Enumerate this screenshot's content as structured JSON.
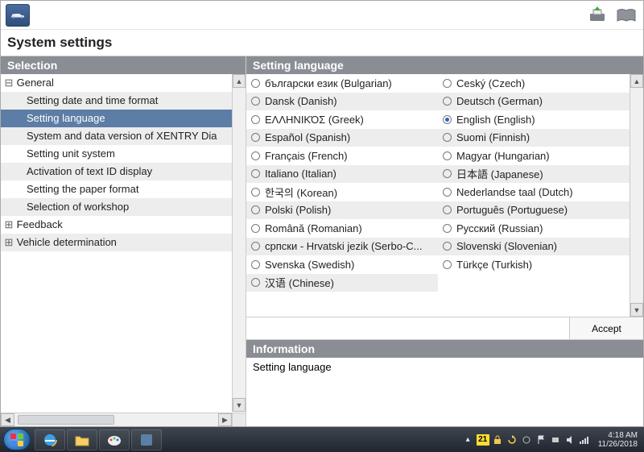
{
  "page_title": "System settings",
  "left_header": "Selection",
  "right_header": "Setting language",
  "info_header": "Information",
  "info_body": "Setting language",
  "accept_label": "Accept",
  "tree": {
    "general": "General",
    "items": [
      "Setting date and time format",
      "Setting language",
      "System and data version of XENTRY Dia",
      "Setting unit system",
      "Activation of text ID display",
      "Setting the paper format",
      "Selection of workshop"
    ],
    "feedback": "Feedback",
    "vehicle": "Vehicle determination",
    "selected_index": 1
  },
  "languages": [
    {
      "l": "български език (Bulgarian)",
      "r": "Ceský (Czech)"
    },
    {
      "l": "Dansk (Danish)",
      "r": "Deutsch (German)"
    },
    {
      "l": "ΕΛΛΗΝΙΚΌΣ (Greek)",
      "r": "English (English)",
      "r_selected": true
    },
    {
      "l": "Español (Spanish)",
      "r": "Suomi (Finnish)"
    },
    {
      "l": "Français (French)",
      "r": "Magyar (Hungarian)"
    },
    {
      "l": "Italiano (Italian)",
      "r": "日本語 (Japanese)"
    },
    {
      "l": "한국의 (Korean)",
      "r": "Nederlandse taal (Dutch)"
    },
    {
      "l": "Polski (Polish)",
      "r": "Português (Portuguese)"
    },
    {
      "l": "Română (Romanian)",
      "r": "Русский (Russian)"
    },
    {
      "l": "српски - Hrvatski jezik (Serbo-C...",
      "r": "Slovenski (Slovenian)"
    },
    {
      "l": "Svenska (Swedish)",
      "r": "Türkçe (Turkish)"
    },
    {
      "l": "汉语 (Chinese)",
      "r": ""
    }
  ],
  "taskbar": {
    "time": "4:18 AM",
    "date": "11/26/2018",
    "day_badge": "21"
  }
}
